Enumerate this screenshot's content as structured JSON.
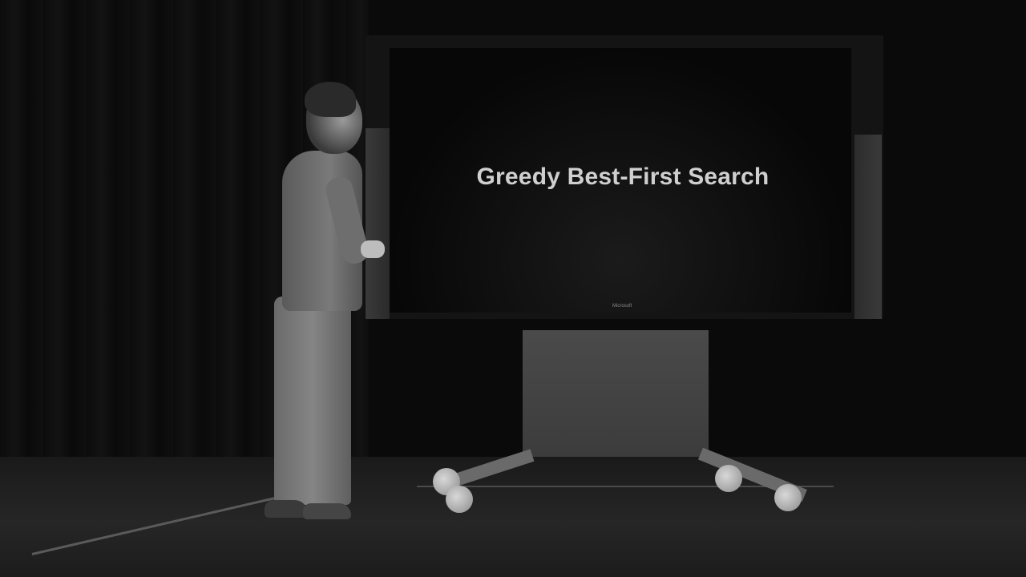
{
  "slide": {
    "title": "Greedy Best-First Search"
  },
  "display": {
    "brand": "Microsoft"
  },
  "colors": {
    "background": "#0a0a0a",
    "slide_text": "#cfcfcf",
    "screen": "#070707"
  }
}
